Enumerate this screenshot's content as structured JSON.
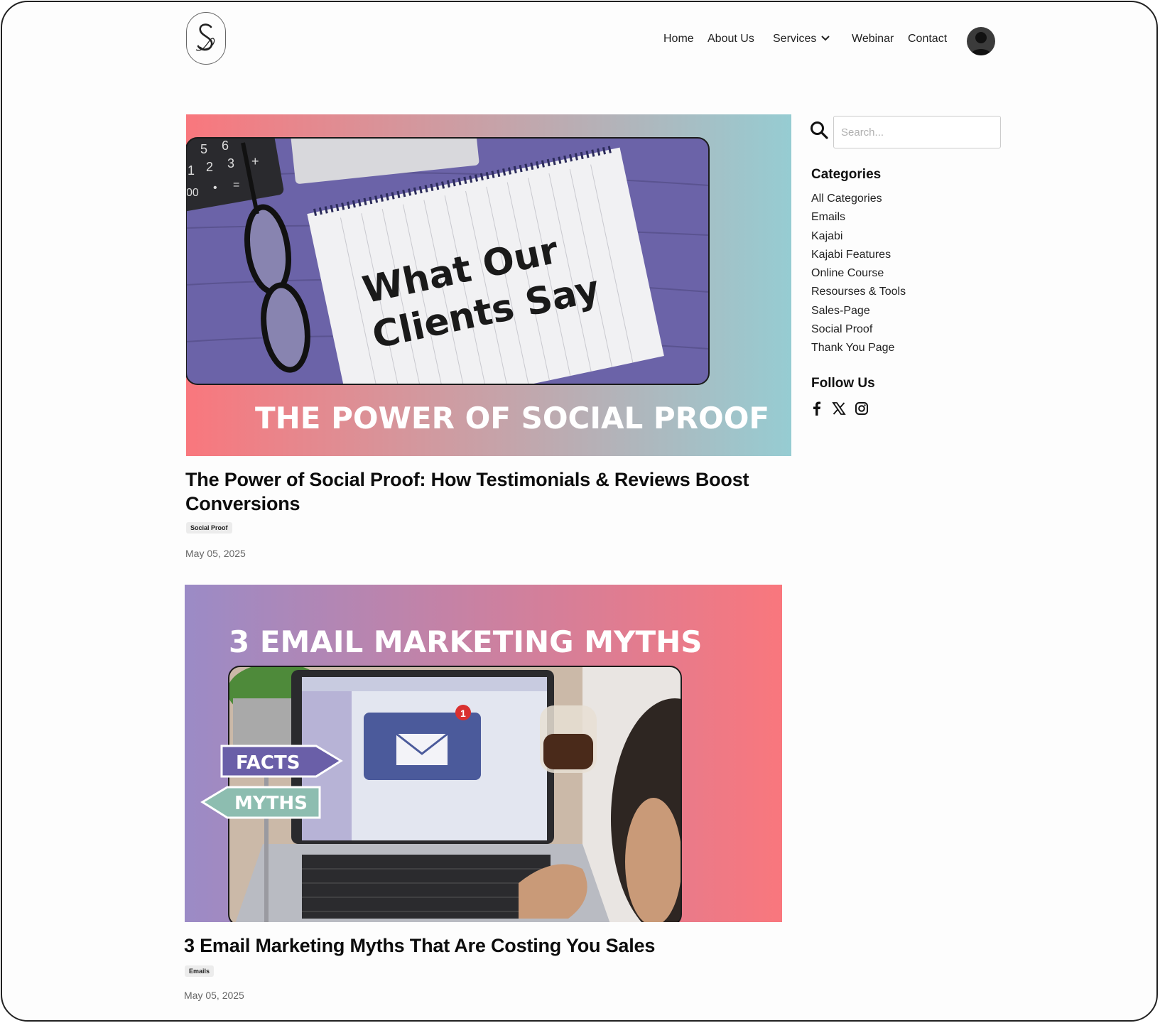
{
  "header": {
    "nav": [
      {
        "label": "Home"
      },
      {
        "label": "About Us"
      },
      {
        "label": "Services"
      },
      {
        "label": "Webinar"
      },
      {
        "label": "Contact"
      }
    ]
  },
  "posts": [
    {
      "image_text_main": [
        "What Our",
        "Clients Say"
      ],
      "image_banner": "THE POWER OF SOCIAL PROOF",
      "calc_keys": [
        "5",
        "6",
        "1",
        "2",
        "3",
        "+",
        "00",
        "•",
        "="
      ],
      "title_lines": [
        "The Power of Social Proof: How Testimonials & Reviews Boost",
        "Conversions"
      ],
      "tag": "Social Proof",
      "date": "May 05, 2025"
    },
    {
      "image_banner": "3 EMAIL MARKETING MYTHS",
      "sign_facts": "FACTS",
      "sign_myths": "MYTHS",
      "notification_count": "1",
      "title": "3 Email Marketing Myths That Are Costing You Sales",
      "tag": "Emails",
      "date": "May 05, 2025"
    }
  ],
  "sidebar": {
    "search_placeholder": "Search...",
    "categories_heading": "Categories",
    "categories": [
      "All Categories",
      "Emails",
      "Kajabi",
      "Kajabi Features",
      "Online Course",
      "Resourses & Tools",
      "Sales-Page",
      "Social Proof",
      "Thank You Page"
    ],
    "follow_heading": "Follow Us",
    "social_icons": [
      "facebook-icon",
      "x-icon",
      "instagram-icon"
    ]
  },
  "colors": {
    "coral": "#f9777d",
    "teal": "#96ccd2",
    "lavender": "#9b8bc6",
    "desk_purple": "#6b63a8"
  }
}
